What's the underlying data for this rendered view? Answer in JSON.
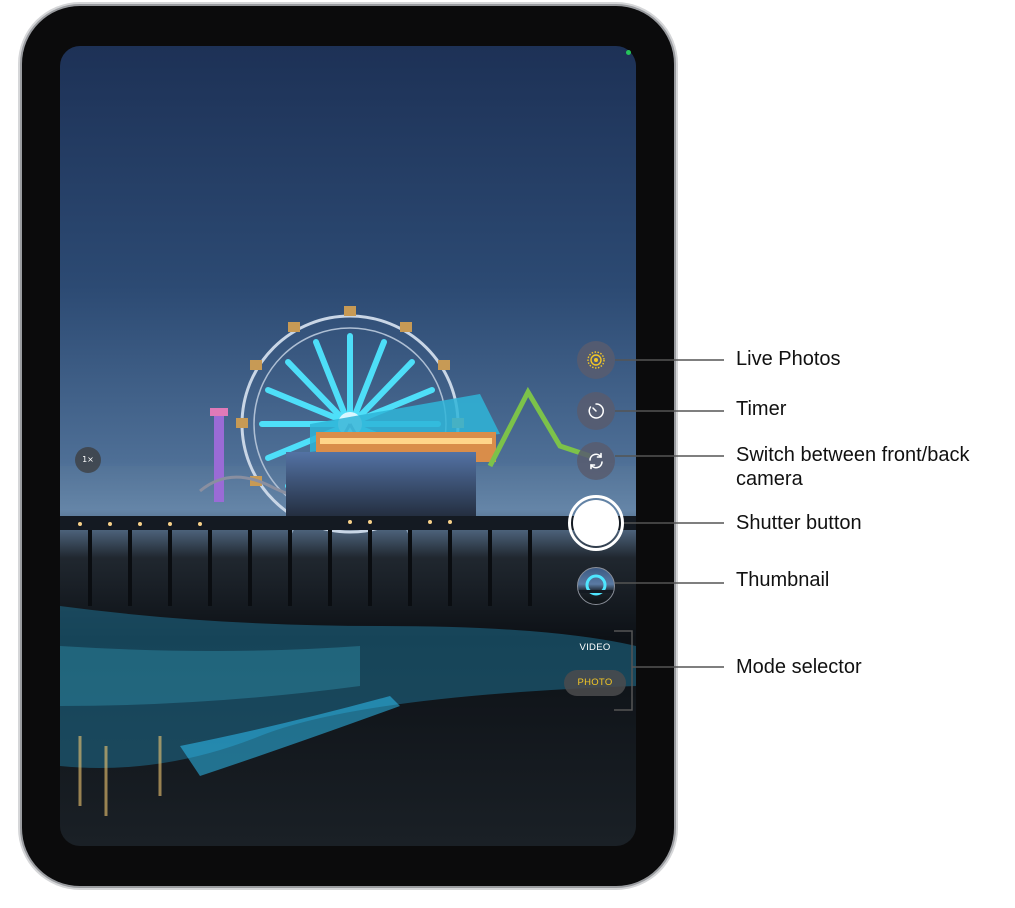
{
  "camera_ui": {
    "zoom_label": "1×",
    "mode_video": "VIDEO",
    "mode_photo": "PHOTO",
    "selected_mode": "PHOTO",
    "accent_color": "#f3c726"
  },
  "callouts": {
    "live_photos": "Live Photos",
    "timer": "Timer",
    "switch_camera": "Switch between front/back camera",
    "shutter": "Shutter button",
    "thumbnail": "Thumbnail",
    "mode_selector": "Mode selector"
  },
  "icons": {
    "live": "live-photos-icon",
    "timer": "timer-icon",
    "switch": "camera-switch-icon"
  }
}
